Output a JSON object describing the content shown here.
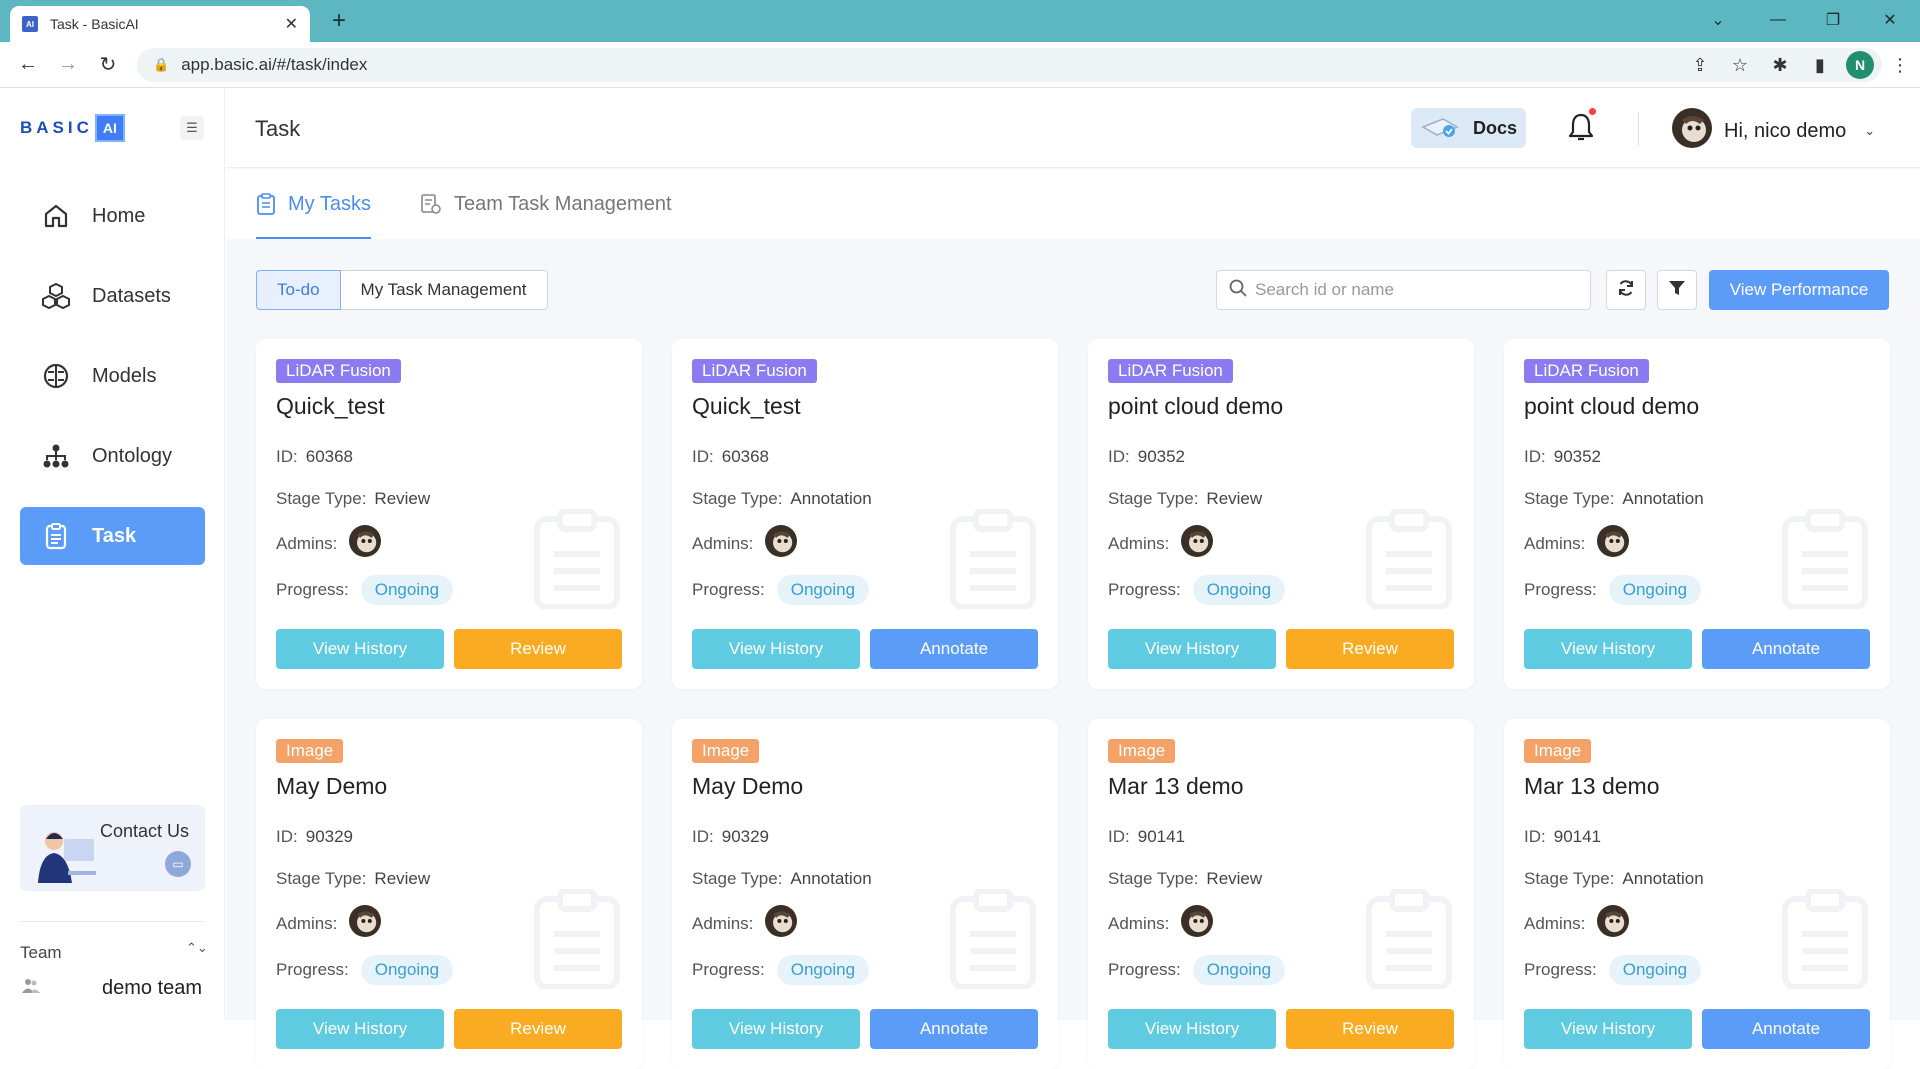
{
  "browser": {
    "tab_title": "Task - BasicAI",
    "url": "app.basic.ai/#/task/index",
    "profile_initial": "N"
  },
  "sidebar": {
    "logo_text": "BASIC",
    "logo_ai": "AI",
    "nav": [
      {
        "label": "Home",
        "icon": "home-icon"
      },
      {
        "label": "Datasets",
        "icon": "cubes-icon"
      },
      {
        "label": "Models",
        "icon": "brain-icon"
      },
      {
        "label": "Ontology",
        "icon": "hierarchy-icon"
      },
      {
        "label": "Task",
        "icon": "clipboard-icon",
        "active": true
      }
    ],
    "contact_label": "Contact Us",
    "team_label": "Team",
    "team_name": "demo team"
  },
  "header": {
    "page_title": "Task",
    "docs_label": "Docs",
    "greeting": "Hi, nico demo"
  },
  "page_tabs": [
    {
      "label": "My Tasks",
      "active": true
    },
    {
      "label": "Team Task Management",
      "active": false
    }
  ],
  "toolbar": {
    "segment_todo": "To-do",
    "segment_mgmt": "My Task Management",
    "search_placeholder": "Search id or name",
    "view_performance": "View Performance"
  },
  "labels": {
    "id": "ID:",
    "stage_type": "Stage Type:",
    "admins": "Admins:",
    "progress": "Progress:",
    "view_history": "View History"
  },
  "cards": [
    {
      "type": "LiDAR Fusion",
      "name": "Quick_test",
      "id": "60368",
      "stage": "Review",
      "progress": "Ongoing",
      "action": "Review"
    },
    {
      "type": "LiDAR Fusion",
      "name": "Quick_test",
      "id": "60368",
      "stage": "Annotation",
      "progress": "Ongoing",
      "action": "Annotate"
    },
    {
      "type": "LiDAR Fusion",
      "name": "point cloud demo",
      "id": "90352",
      "stage": "Review",
      "progress": "Ongoing",
      "action": "Review"
    },
    {
      "type": "LiDAR Fusion",
      "name": "point cloud demo",
      "id": "90352",
      "stage": "Annotation",
      "progress": "Ongoing",
      "action": "Annotate"
    },
    {
      "type": "Image",
      "name": "May Demo",
      "id": "90329",
      "stage": "Review",
      "progress": "Ongoing",
      "action": "Review"
    },
    {
      "type": "Image",
      "name": "May Demo",
      "id": "90329",
      "stage": "Annotation",
      "progress": "Ongoing",
      "action": "Annotate"
    },
    {
      "type": "Image",
      "name": "Mar 13 demo",
      "id": "90141",
      "stage": "Review",
      "progress": "Ongoing",
      "action": "Review"
    },
    {
      "type": "Image",
      "name": "Mar 13 demo",
      "id": "90141",
      "stage": "Annotation",
      "progress": "Ongoing",
      "action": "Annotate"
    }
  ],
  "colors": {
    "tabbar": "#5cb7c0",
    "primary": "#5b9cf8",
    "review": "#fbab22",
    "history": "#5fcbe0",
    "lidar_badge": "#8a7bf0",
    "image_badge": "#f3a268"
  }
}
